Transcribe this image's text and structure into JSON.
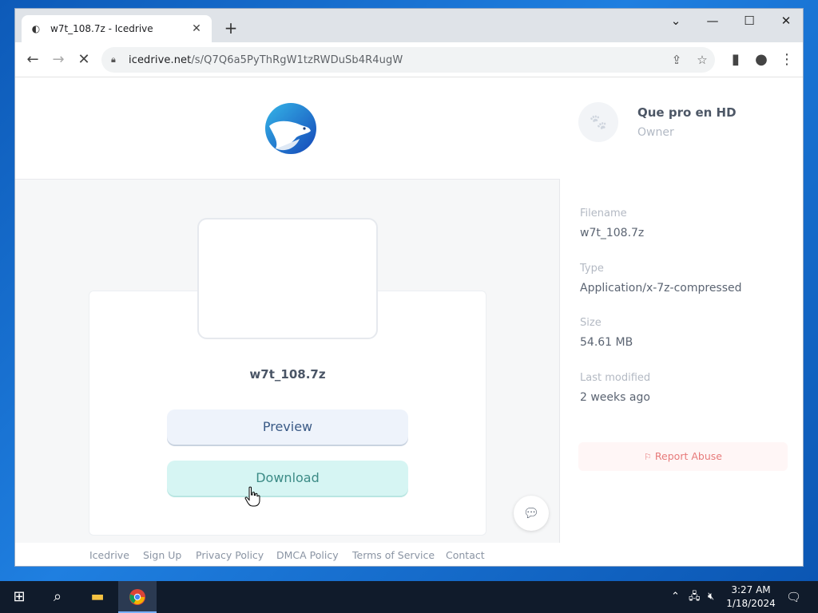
{
  "browser": {
    "tab_title": "w7t_108.7z - Icedrive",
    "url_host": "icedrive.net",
    "url_path": "/s/Q7Q6a5PyThRgW1tzRWDuSb4R4ugW"
  },
  "file": {
    "name": "w7t_108.7z",
    "preview_label": "Preview",
    "download_label": "Download"
  },
  "footer": {
    "links": [
      "Icedrive",
      "Sign Up",
      "Privacy Policy",
      "DMCA Policy",
      "Terms of Service",
      "Contact"
    ]
  },
  "owner": {
    "name": "Que pro en HD",
    "role": "Owner"
  },
  "details": {
    "filename_label": "Filename",
    "filename_value": "w7t_108.7z",
    "type_label": "Type",
    "type_value": "Application/x-7z-compressed",
    "size_label": "Size",
    "size_value": "54.61 MB",
    "modified_label": "Last modified",
    "modified_value": "2 weeks ago"
  },
  "report_label": "Report Abuse",
  "taskbar": {
    "time": "3:27 AM",
    "date": "1/18/2024"
  },
  "colors": {
    "accent_blue": "#1f7fe0",
    "preview_bg": "#eef3fb",
    "download_bg": "#d6f5f3",
    "report_text": "#e77a7a"
  }
}
